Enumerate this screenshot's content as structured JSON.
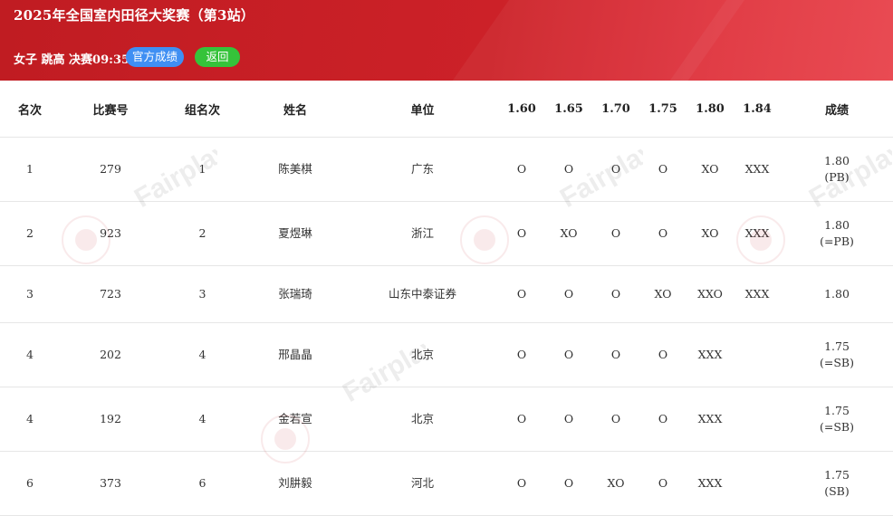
{
  "header": {
    "title": "2025年全国室内田径大奖赛（第3站）",
    "event": "女子 跳高 决赛09:35",
    "official_button": "官方成绩",
    "back_button": "返回"
  },
  "table": {
    "columns": [
      "名次",
      "比赛号",
      "组名次",
      "姓名",
      "单位",
      "1.60",
      "1.65",
      "1.70",
      "1.75",
      "1.80",
      "1.84",
      "成绩"
    ],
    "rows": [
      {
        "rank": "1",
        "bib": "279",
        "group_rank": "1",
        "name": "陈美棋",
        "unit": "广东",
        "h1": "O",
        "h2": "O",
        "h3": "O",
        "h4": "O",
        "h5": "XO",
        "h6": "XXX",
        "result": "1.80",
        "note": "(PB)"
      },
      {
        "rank": "2",
        "bib": "923",
        "group_rank": "2",
        "name": "夏煜琳",
        "unit": "浙江",
        "h1": "O",
        "h2": "XO",
        "h3": "O",
        "h4": "O",
        "h5": "XO",
        "h6": "XXX",
        "result": "1.80",
        "note": "(=PB)"
      },
      {
        "rank": "3",
        "bib": "723",
        "group_rank": "3",
        "name": "张瑞琦",
        "unit": "山东中泰证券",
        "h1": "O",
        "h2": "O",
        "h3": "O",
        "h4": "XO",
        "h5": "XXO",
        "h6": "XXX",
        "result": "1.80",
        "note": ""
      },
      {
        "rank": "4",
        "bib": "202",
        "group_rank": "4",
        "name": "邢晶晶",
        "unit": "北京",
        "h1": "O",
        "h2": "O",
        "h3": "O",
        "h4": "O",
        "h5": "XXX",
        "h6": "",
        "result": "1.75",
        "note": "(=SB)"
      },
      {
        "rank": "4",
        "bib": "192",
        "group_rank": "4",
        "name": "金若宣",
        "unit": "北京",
        "h1": "O",
        "h2": "O",
        "h3": "O",
        "h4": "O",
        "h5": "XXX",
        "h6": "",
        "result": "1.75",
        "note": "(=SB)"
      },
      {
        "rank": "6",
        "bib": "373",
        "group_rank": "6",
        "name": "刘肼毅",
        "unit": "河北",
        "h1": "O",
        "h2": "O",
        "h3": "XO",
        "h4": "O",
        "h5": "XXX",
        "h6": "",
        "result": "1.75",
        "note": "(SB)"
      }
    ]
  },
  "watermark": {
    "text": "Fairplay"
  }
}
